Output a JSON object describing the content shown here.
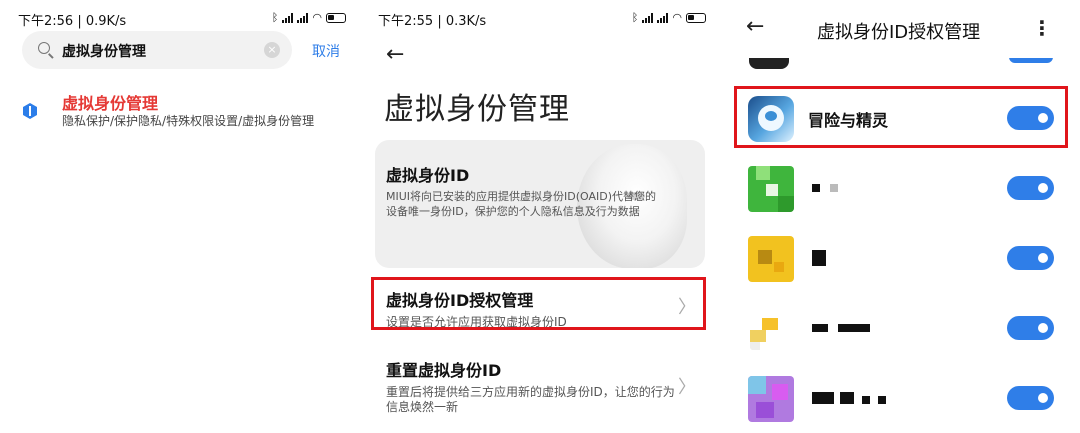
{
  "panel1": {
    "status": {
      "time": "下午2:56 | 0.9K/s"
    },
    "search": {
      "query": "虚拟身份管理",
      "clear_glyph": "×",
      "cancel": "取消"
    },
    "result": {
      "title": "虚拟身份管理",
      "path": "隐私保护/保护隐私/特殊权限设置/虚拟身份管理",
      "icon": "shield-icon"
    }
  },
  "panel2": {
    "status": {
      "time": "下午2:55 | 0.3K/s"
    },
    "back_glyph": "←",
    "page_title": "虚拟身份管理",
    "card": {
      "title": "虚拟身份ID",
      "desc": "MIUI将向已安装的应用提供虚拟身份ID(OAID)代替您的设备唯一身份ID，保护您的个人隐私信息及行为数据"
    },
    "rows": [
      {
        "title": "虚拟身份ID授权管理",
        "subtitle": "设置是否允许应用获取虚拟身份ID"
      },
      {
        "title": "重置虚拟身份ID",
        "subtitle": "重置后将提供给三方应用新的虚拟身份ID，让您的行为信息焕然一新"
      }
    ],
    "chevron": "〉"
  },
  "panel3": {
    "back_glyph": "←",
    "title": "虚拟身份ID授权管理",
    "more_glyph": "⋮",
    "apps": [
      {
        "name": "冒险与精灵",
        "enabled": true
      },
      {
        "name": "",
        "enabled": true
      },
      {
        "name": "",
        "enabled": true
      },
      {
        "name": "",
        "enabled": true
      },
      {
        "name": "",
        "enabled": true
      }
    ]
  },
  "colors": {
    "accent": "#2f7ee8",
    "highlight": "#e0151b",
    "result_title": "#e53935"
  }
}
